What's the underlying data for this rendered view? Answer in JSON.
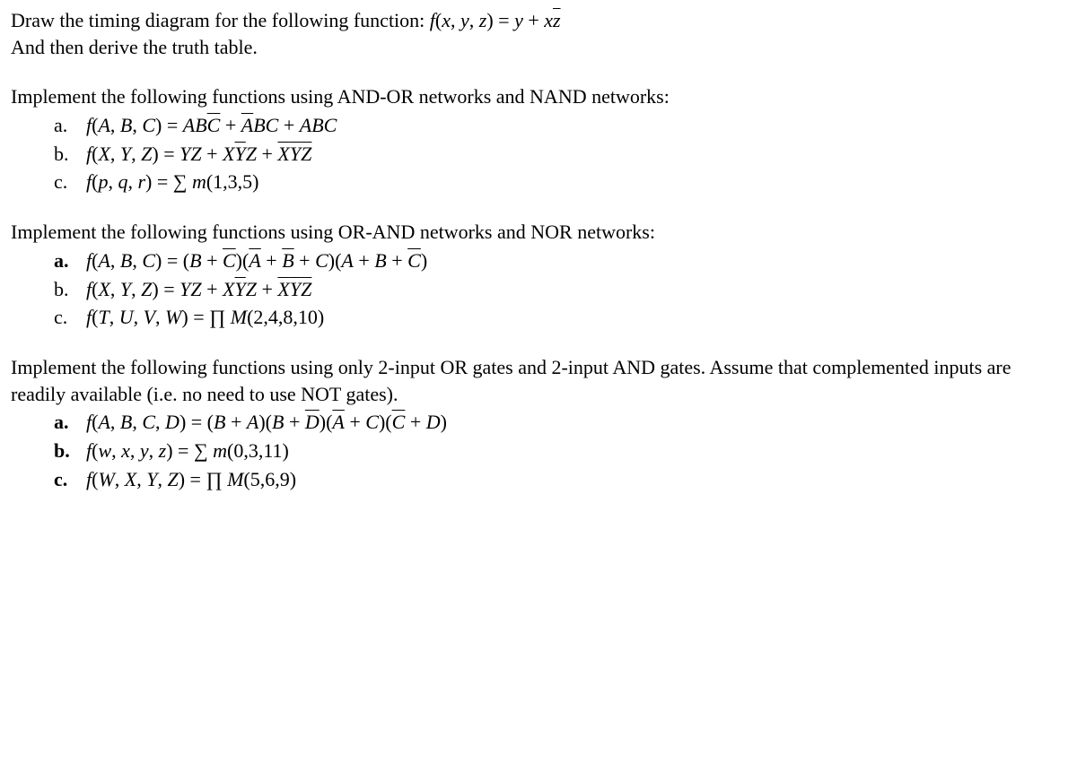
{
  "p1_line1_a": "Draw the timing diagram for the following function: ",
  "p1_line1_b_html": "<span class='math'>f</span>(<span class='math'>x</span>, <span class='math'>y</span>, <span class='math'>z</span>) = <span class='math'>y</span> + <span class='math'>x<span class='ov'>z</span></span>",
  "p1_line2": "And then derive the truth table.",
  "p2_intro": "Implement the following functions using AND-OR networks and NAND networks:",
  "p2_a_lbl": "a.",
  "p2_a_html": "<span class='math'>f</span>(<span class='math'>A</span>, <span class='math'>B</span>, <span class='math'>C</span>) = <span class='math'>AB<span class='ov'>C</span></span> + <span class='math'><span class='ov'>A</span>BC</span> + <span class='math'>ABC</span>",
  "p2_b_lbl": "b.",
  "p2_b_html": "<span class='math'>f</span>(<span class='math'>X</span>, <span class='math'>Y</span>, <span class='math'>Z</span>) = <span class='math'>YZ</span> + <span class='math'>X<span class='ov'>Y</span>Z</span> + <span class='math'><span class='ov'>X</span><span class='ov'>Y</span><span class='ov'>Z</span></span>",
  "p2_c_lbl": "c.",
  "p2_c_html": "<span class='math'>f</span>(<span class='math'>p</span>, <span class='math'>q</span>, <span class='math'>r</span>) = <span class='rm'>∑</span> <span class='math'>m</span>(1,3,5)",
  "p3_intro": "Implement the following functions using OR-AND networks and NOR networks:",
  "p3_a_lbl": "a.",
  "p3_a_html": "<span class='math'>f</span>(<span class='math'>A</span>, <span class='math'>B</span>, <span class='math'>C</span>) = (<span class='math'>B</span> + <span class='math'><span class='ov'>C</span></span>)(<span class='math'><span class='ov'>A</span></span> + <span class='math'><span class='ov'>B</span></span> + <span class='math'>C</span>)(<span class='math'>A</span> + <span class='math'>B</span> + <span class='math'><span class='ov'>C</span></span>)",
  "p3_b_lbl": "b.",
  "p3_b_html": "<span class='math'>f</span>(<span class='math'>X</span>, <span class='math'>Y</span>, <span class='math'>Z</span>) = <span class='math'>YZ</span> + <span class='math'>X<span class='ov'>Y</span>Z</span> + <span class='math'><span class='ov'>X</span><span class='ov'>Y</span><span class='ov'>Z</span></span>",
  "p3_c_lbl": "c.",
  "p3_c_html": "<span class='math'>f</span>(<span class='math'>T</span>, <span class='math'>U</span>, <span class='math'>V</span>, <span class='math'>W</span>) = <span class='rm'>∏</span> <span class='math'>M</span>(2,4,8,10)",
  "p4_intro_a": "Implement the following functions using only 2-input OR gates and 2-input AND gates. Assume that complemented inputs are readily available (i.e. no need to use NOT gates).",
  "p4_a_lbl": "a.",
  "p4_a_html": "<span class='math'>f</span>(<span class='math'>A</span>, <span class='math'>B</span>, <span class='math'>C</span>, <span class='math'>D</span>) = (<span class='math'>B</span> + <span class='math'>A</span>)(<span class='math'>B</span> + <span class='math'><span class='ov'>D</span></span>)(<span class='math'><span class='ov'>A</span></span> + <span class='math'>C</span>)(<span class='math'><span class='ov'>C</span></span> + <span class='math'>D</span>)",
  "p4_b_lbl": "b.",
  "p4_b_html": "<span class='math'>f</span>(<span class='math'>w</span>, <span class='math'>x</span>, <span class='math'>y</span>, <span class='math'>z</span>) = <span class='rm'>∑</span> <span class='math'>m</span>(0,3,11)",
  "p4_c_lbl": "c.",
  "p4_c_html": "<span class='math'>f</span>(<span class='math'>W</span>, <span class='math'>X</span>, <span class='math'>Y</span>, <span class='math'>Z</span>) = <span class='rm'>∏</span> <span class='math'>M</span>(5,6,9)"
}
